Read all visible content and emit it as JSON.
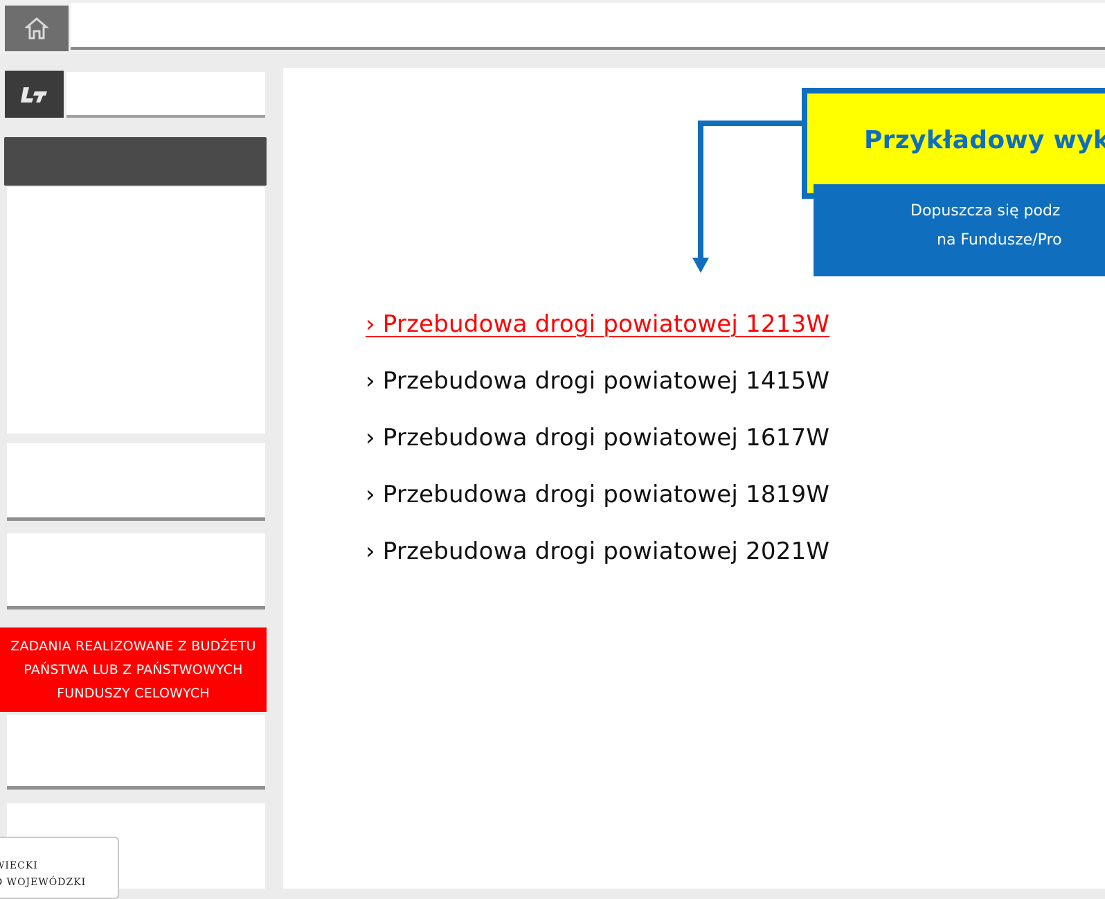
{
  "topbar": {
    "home_icon": "home-icon"
  },
  "sidebar": {
    "logo_icon": "logo-icon",
    "promo": {
      "text": "ZADANIA REALIZOWANE Z BUDŻETU PAŃSTWA LUB Z PAŃSTWOWYCH FUNDUSZY CELOWYCH",
      "background": "#ff0000"
    },
    "emblem": {
      "line1": "WIECKI",
      "line2": "D WOJEWÓDZKI"
    }
  },
  "callout": {
    "title": "Przykładowy wyk",
    "body_line1": "Dopuszcza się podz",
    "body_line2": "na Fundusze/Pro",
    "colors": {
      "yellow": "#ffff00",
      "blue": "#0f6fbe"
    }
  },
  "roads": {
    "items": [
      {
        "label": "› Przebudowa drogi powiatowej 1213W",
        "active": true
      },
      {
        "label": "› Przebudowa drogi powiatowej 1415W",
        "active": false
      },
      {
        "label": "› Przebudowa drogi powiatowej 1617W",
        "active": false
      },
      {
        "label": "› Przebudowa drogi powiatowej 1819W",
        "active": false
      },
      {
        "label": "› Przebudowa drogi powiatowej 2021W",
        "active": false
      }
    ],
    "active_color": "#ff0000"
  }
}
